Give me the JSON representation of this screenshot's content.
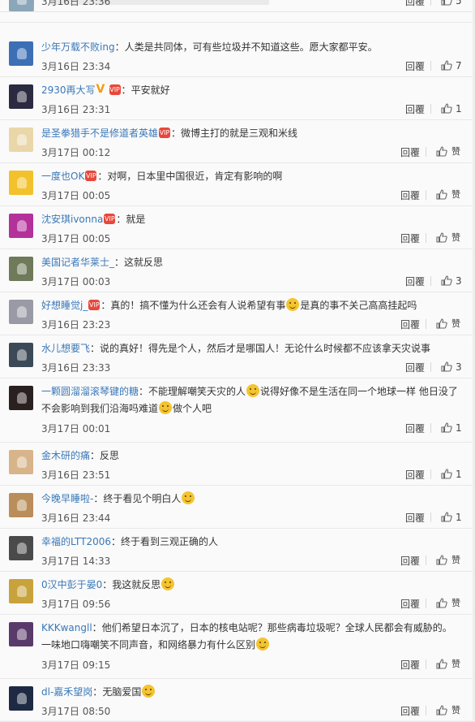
{
  "reply_label": "回覆",
  "like_fallback": "赞",
  "vip_badge_text": "VIP",
  "comments": [
    {
      "user": "",
      "text": "",
      "time": "3月16日 23:36",
      "likes": "5",
      "avatar": "#8aa6b8",
      "partial": true
    },
    {
      "user": "少年万载不败ing",
      "text": "人类是共同体，可有些垃圾并不知道这些。愿大家都平安。",
      "time": "3月16日 23:34",
      "likes": "7",
      "avatar": "#3c6fb6"
    },
    {
      "user": "2930再大写",
      "crown": true,
      "vip": true,
      "text": "平安就好",
      "time": "3月16日 23:31",
      "likes": "1",
      "avatar": "#2a2a40"
    },
    {
      "user": "是圣拳猎手不是修道者英雄",
      "vip": true,
      "text": "微博主打的就是三观和米线",
      "time": "3月17日 00:12",
      "likes": "",
      "avatar": "#e9d7a9"
    },
    {
      "user": "一度也OK",
      "vip": true,
      "text": "对啊，日本里中国很近，肯定有影响的啊",
      "time": "3月17日 00:05",
      "likes": "",
      "avatar": "#f3c12c"
    },
    {
      "user": "沈安琪ivonna",
      "vip": true,
      "text": "就是",
      "time": "3月17日 00:05",
      "likes": "",
      "avatar": "#b4309a"
    },
    {
      "user": "美国记者华莱士_",
      "text": "这就反思",
      "time": "3月17日 00:03",
      "likes": "3",
      "avatar": "#6e7a5a"
    },
    {
      "user": "好想睡觉j_",
      "vip": true,
      "text": "真的！搞不懂为什么还会有人说希望有事",
      "emoji": true,
      "text2": "是真的事不关己高高挂起吗",
      "time": "3月16日 23:23",
      "likes": "",
      "avatar": "#9a9aa6"
    },
    {
      "user": "水儿想要飞",
      "text": "说的真好！得先是个人，然后才是哪国人！无论什么时候都不应该拿天灾说事",
      "time": "3月16日 23:33",
      "likes": "3",
      "avatar": "#3c4a58"
    },
    {
      "user": "一颗圆溜溜滚琴键的糖",
      "text": "不能理解嘲笑天灾的人",
      "emoji": true,
      "text2": "说得好像不是生活在同一个地球一样 他日没了不会影响到我们沿海吗难道",
      "emoji2": true,
      "text3": "做个人吧",
      "time": "3月17日 00:01",
      "likes": "1",
      "avatar": "#2b2020",
      "two_lines": true
    },
    {
      "user": "金木研的痛",
      "text": "反思",
      "time": "3月16日 23:51",
      "likes": "1",
      "avatar": "#d8b48a"
    },
    {
      "user": "今晚早睡啦-",
      "text": "终于看见个明白人",
      "emoji": true,
      "time": "3月16日 23:44",
      "likes": "1",
      "avatar": "#b98e5a"
    },
    {
      "user": "幸福的LTT2006",
      "text": "终于看到三观正确的人",
      "time": "3月17日 14:33",
      "likes": "",
      "avatar": "#4a4a4a"
    },
    {
      "user": "0汉中彭于晏0",
      "text": "我这就反思",
      "emoji": true,
      "time": "3月17日 09:56",
      "likes": "",
      "avatar": "#c8a23a"
    },
    {
      "user": "KKKwangll",
      "text": "他们希望日本沉了，日本的核电站呢？那些病毒垃圾呢？全球人民都会有威胁的。一味地口嗨嘲笑不同声音，和网络暴力有什么区别",
      "emoji": true,
      "time": "3月17日 09:15",
      "likes": "",
      "avatar": "#5a3a6a",
      "two_lines": true
    },
    {
      "user": "dl-嘉禾望岗",
      "text": "无脑爱国",
      "emoji": true,
      "time": "3月17日 08:50",
      "likes": "",
      "avatar": "#1e2a44"
    }
  ]
}
